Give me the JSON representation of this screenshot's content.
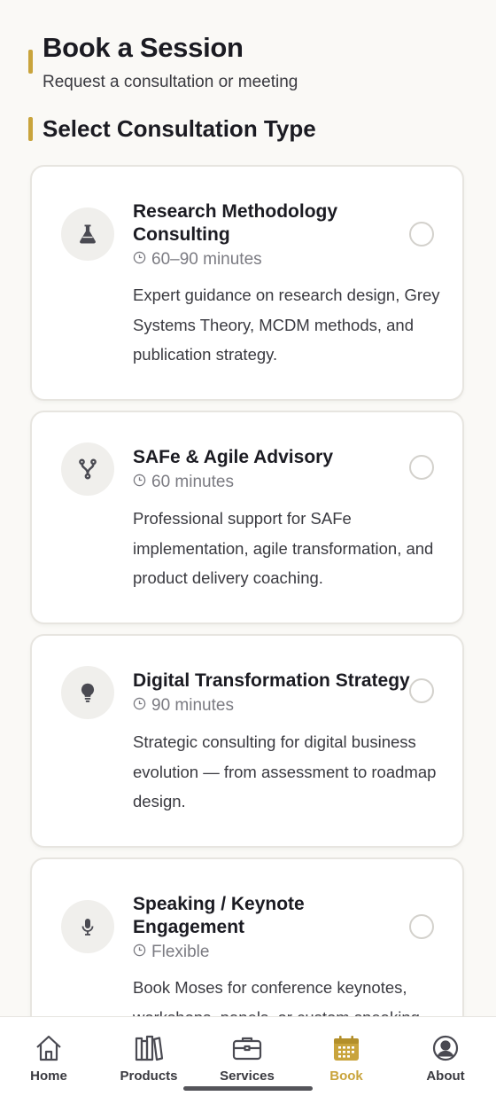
{
  "header": {
    "title": "Book a Session",
    "subtitle": "Request a consultation or meeting"
  },
  "section": {
    "title": "Select Consultation Type"
  },
  "cards": [
    {
      "icon": "flask-icon",
      "title": "Research Methodology Consulting",
      "duration": "60–90 minutes",
      "description": "Expert guidance on research design, Grey Systems Theory, MCDM methods, and publication strategy.",
      "selected": false
    },
    {
      "icon": "branch-icon",
      "title": "SAFe & Agile Advisory",
      "duration": "60 minutes",
      "description": "Professional support for SAFe implementation, agile transformation, and product delivery coaching.",
      "selected": false
    },
    {
      "icon": "lightbulb-icon",
      "title": "Digital Transformation Strategy",
      "duration": "90 minutes",
      "description": "Strategic consulting for digital business evolution — from assessment to roadmap design.",
      "selected": false
    },
    {
      "icon": "microphone-icon",
      "title": "Speaking / Keynote Engagement",
      "duration": "Flexible",
      "description": "Book Moses for conference keynotes, workshops, panels, or custom speaking",
      "selected": false
    }
  ],
  "tabbar": {
    "items": [
      {
        "label": "Home",
        "icon": "house-icon",
        "active": false
      },
      {
        "label": "Products",
        "icon": "books-icon",
        "active": false
      },
      {
        "label": "Services",
        "icon": "briefcase-icon",
        "active": false
      },
      {
        "label": "Book",
        "icon": "calendar-icon",
        "active": true
      },
      {
        "label": "About",
        "icon": "user-circle-icon",
        "active": false
      }
    ]
  },
  "colors": {
    "accent": "#C9A43C",
    "background": "#FAF9F6",
    "card": "#FFFFFF",
    "text": "#1B1B22",
    "muted": "#7B7B82"
  }
}
